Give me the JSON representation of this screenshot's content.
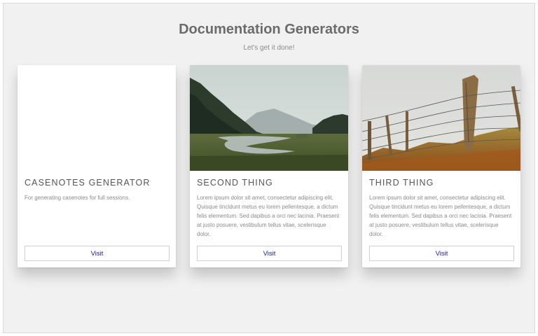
{
  "page": {
    "title": "Documentation Generators",
    "subtitle": "Let's get it done!"
  },
  "cards": [
    {
      "title": "CASENOTES GENERATOR",
      "description": "For generating casenotes for full sessions.",
      "button_label": "Visit",
      "image": "none"
    },
    {
      "title": "SECOND THING",
      "description": "Lorem ipsum dolor sit amet, consectetur adipiscing elit. Quisque tincidunt metus eu lorem pellentesque, a dictum felis elementum. Sed dapibus a orci nec lacinia. Praesent at justo posuere, vestibulum tellus vitae, scelerisque dolor.",
      "button_label": "Visit",
      "image": "landscape-river-photo"
    },
    {
      "title": "THIRD THING",
      "description": "Lorem ipsum dolor sit amet, consectetur adipiscing elit. Quisque tincidunt metus eu lorem pellentesque, a dictum felis elementum. Sed dapibus a orci nec lacinia. Praesent at justo posuere, vestibulum tellus vitae, scelerisque dolor.",
      "button_label": "Visit",
      "image": "barbed-wire-fence-photo"
    }
  ],
  "colors": {
    "background": "#f1f1f1",
    "card": "#ffffff",
    "title_text": "#6b6b6b",
    "button_text": "#1a1a8c"
  }
}
